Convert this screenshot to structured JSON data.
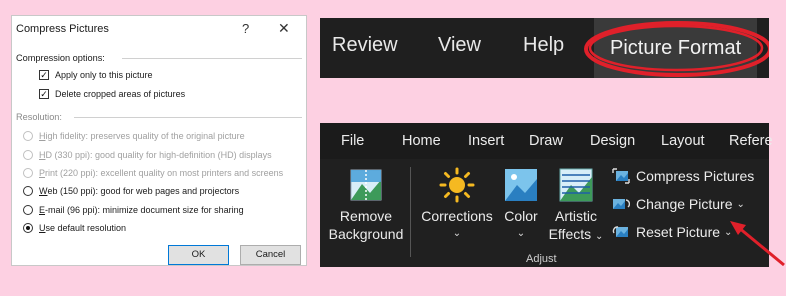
{
  "dialog": {
    "title": "Compress Pictures",
    "help": "?",
    "close": "✕",
    "compression_label": "Compression options:",
    "opt1": "Apply only to this picture",
    "opt2": "Delete cropped areas of pictures",
    "resolution_label": "Resolution:",
    "res": [
      {
        "k": "H",
        "rest": "igh fidelity: preserves quality of the original picture"
      },
      {
        "k": "H",
        "rest": "D (330 ppi): good quality for high-definition (HD) displays"
      },
      {
        "k": "P",
        "rest": "rint (220 ppi): excellent quality on most printers and screens"
      },
      {
        "k": "W",
        "rest": "eb (150 ppi): good for web pages and projectors"
      },
      {
        "k": "E",
        "rest": "-mail (96 ppi): minimize document size for sharing"
      },
      {
        "k": "U",
        "rest": "se default resolution"
      }
    ],
    "ok": "OK",
    "cancel": "Cancel"
  },
  "tabbar": {
    "tabs": [
      "Review",
      "View",
      "Help",
      "Picture Format"
    ],
    "highlight_color": "#e0202a"
  },
  "ribbon": {
    "menu": [
      "File",
      "Home",
      "Insert",
      "Draw",
      "Design",
      "Layout",
      "Refere"
    ],
    "remove_bg_1": "Remove",
    "remove_bg_2": "Background",
    "corrections": "Corrections",
    "color": "Color",
    "artistic_1": "Artistic",
    "artistic_2": "Effects",
    "compress": "Compress Pictures",
    "change": "Change Picture",
    "reset": "Reset Picture",
    "group": "Adjust",
    "arrow_color": "#e0202a"
  }
}
